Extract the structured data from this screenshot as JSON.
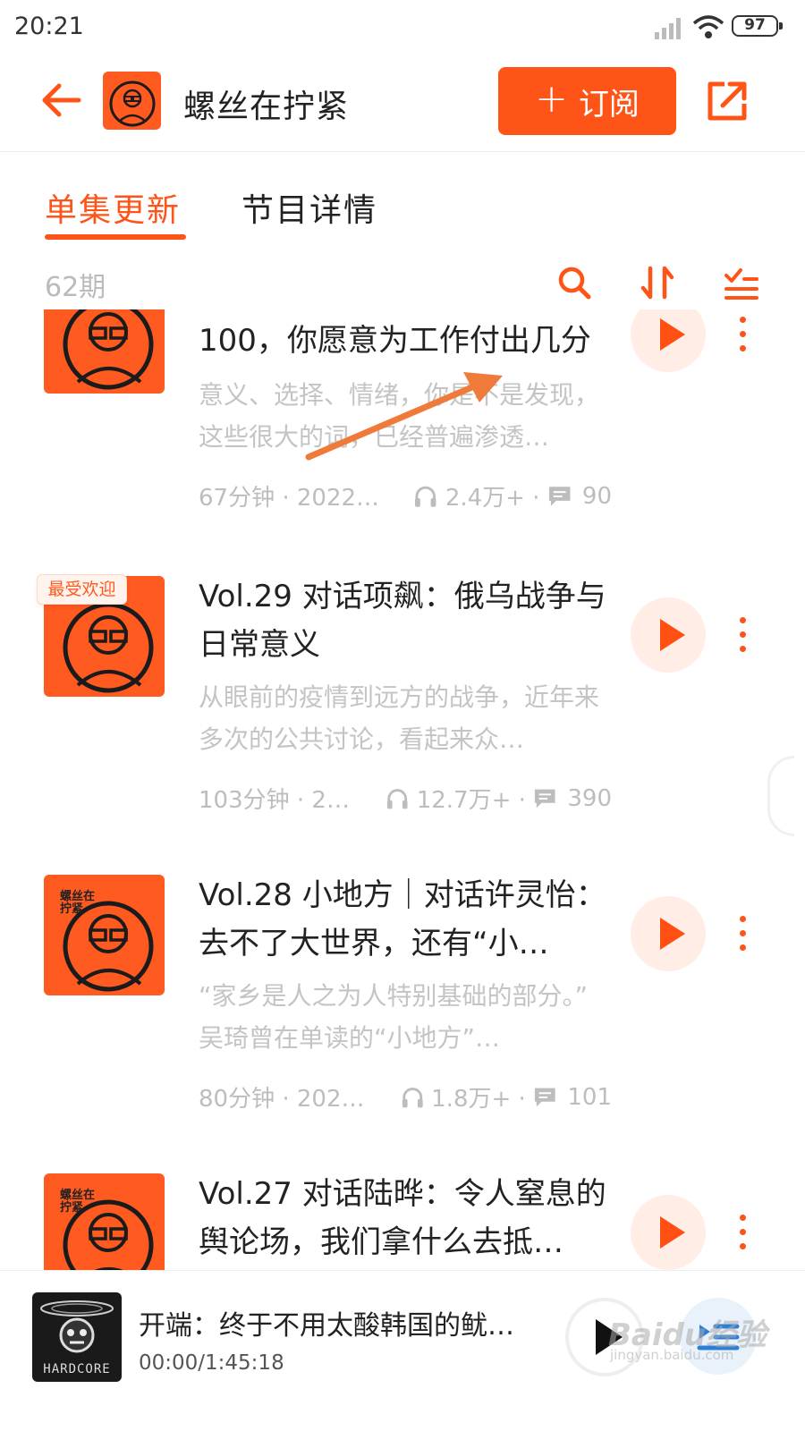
{
  "status_bar": {
    "time": "20:21",
    "battery": "97"
  },
  "header": {
    "title": "螺丝在拧紧",
    "subscribe_label": "订阅",
    "subscribe_plus": "+"
  },
  "tabs": [
    {
      "label": "单集更新"
    },
    {
      "label": "节目详情"
    }
  ],
  "list": {
    "count": "62期"
  },
  "cover_text": "螺丝在拧紧",
  "episodes": [
    {
      "title": "100，你愿意为工作付出几分",
      "desc": "意义、选择、情绪，你是不是发现，这些很大的词，已经普遍渗透…",
      "duration": "67分钟 · 2022/…",
      "plays": "2.4万+ ·",
      "comments": "90"
    },
    {
      "badge": "最受欢迎",
      "title": "Vol.29 对话项飙：俄乌战争与日常意义",
      "desc": "从眼前的疫情到远方的战争，近年来多次的公共讨论，看起来众…",
      "duration": "103分钟 · 20…",
      "plays": "12.7万+ ·",
      "comments": "390"
    },
    {
      "title": "Vol.28 小地方｜对话许灵怡：去不了大世界，还有“小…",
      "desc": "“家乡是人之为人特别基础的部分。” 吴琦曾在单读的“小地方”…",
      "duration": "80分钟 · 2022…",
      "plays": "1.8万+ ·",
      "comments": "101"
    },
    {
      "title": "Vol.27 对话陆晔：令人窒息的舆论场，我们拿什么去抵…",
      "desc": "",
      "duration": "",
      "plays": "",
      "comments": ""
    }
  ],
  "player": {
    "title": "开端：终于不用太酸韩国的鱿…",
    "time": "00:00/1:45:18",
    "cover_text": "HARDCORE"
  },
  "watermark": {
    "main": "Baidu经验",
    "sub": "jingyan.baidu.com"
  },
  "colors": {
    "accent": "#ff5417",
    "muted_text": "#c4c4c4"
  }
}
